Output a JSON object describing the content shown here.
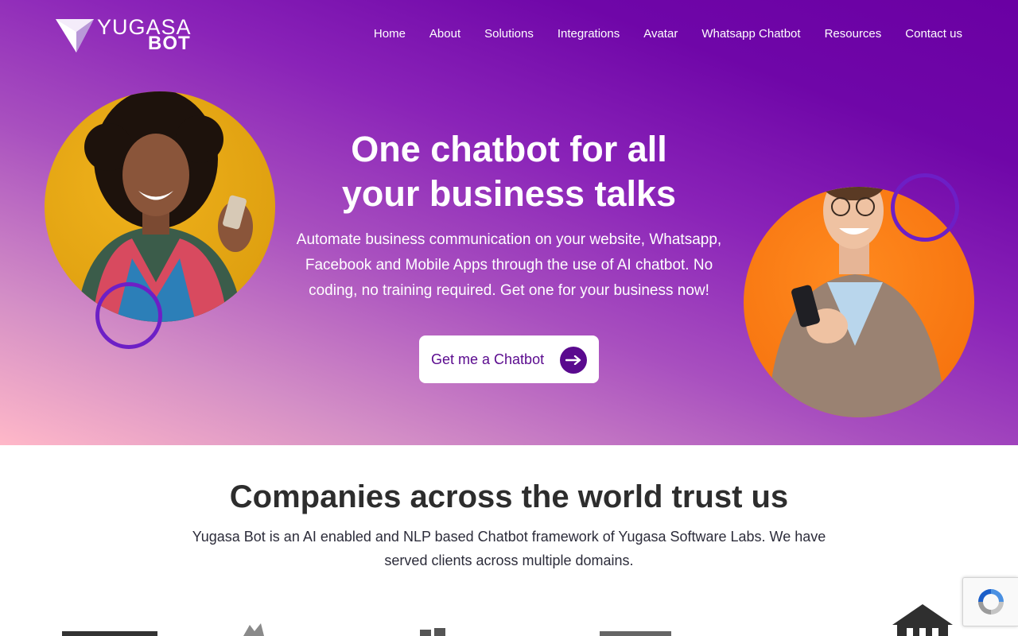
{
  "brand": {
    "logo_top": "YUGASA",
    "logo_bottom": "BOT"
  },
  "nav": {
    "items": [
      "Home",
      "About",
      "Solutions",
      "Integrations",
      "Avatar",
      "Whatsapp Chatbot",
      "Resources",
      "Contact us"
    ]
  },
  "hero": {
    "title_line1": "One chatbot for all",
    "title_line2": "your business talks",
    "subtitle": "Automate business communication on your website, Whatsapp, Facebook and Mobile Apps through the use of AI chatbot. No coding, no training required. Get one for your business now!",
    "cta_label": "Get me a Chatbot"
  },
  "trust": {
    "title": "Companies across the world trust us",
    "description": "Yugasa Bot is an AI enabled and NLP based Chatbot framework of Yugasa Software Labs. We have served clients across multiple domains."
  },
  "colors": {
    "hero_gradient_start": "#ffb8c8",
    "hero_gradient_end": "#6a00a3",
    "cta_text": "#5a0a8e",
    "circle_left": "#e5a512",
    "circle_right": "#f6720e",
    "ring": "#6d1fc6"
  },
  "icons": {
    "cta": "arrow-right-icon",
    "recaptcha": "recaptcha-icon"
  }
}
